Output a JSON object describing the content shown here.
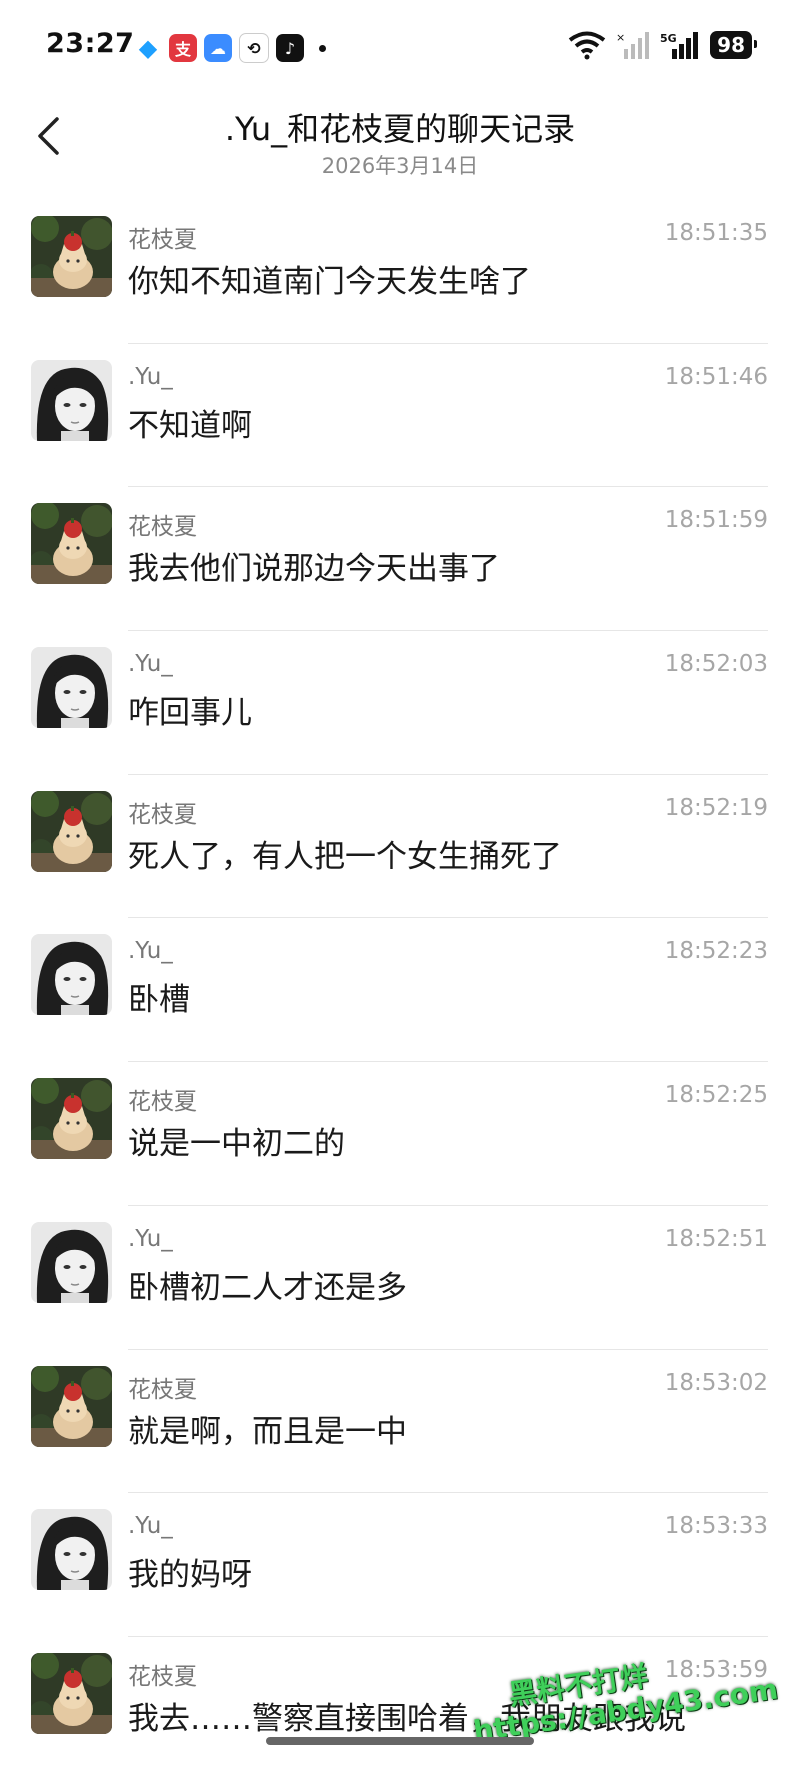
{
  "status_bar": {
    "time": "23:27",
    "app_icons": [
      {
        "name": "qq-icon",
        "color": "#1ea0ff",
        "glyph": "◆"
      },
      {
        "name": "alipay-icon",
        "color": "#e2373f",
        "glyph": "支"
      },
      {
        "name": "weather-icon",
        "color": "#3b8cff",
        "glyph": "☁"
      },
      {
        "name": "sync-app-icon",
        "color": "#ffffff",
        "glyph": "⟲"
      },
      {
        "name": "tiktok-icon",
        "color": "#111111",
        "glyph": "♪"
      }
    ],
    "network": "5G",
    "battery": "98"
  },
  "header": {
    "title": ".Yu_和花枝夏的聊天记录",
    "date": "2026年3月14日"
  },
  "messages": [
    {
      "sender": "花枝夏",
      "time": "18:51:35",
      "text": "你知不知道南门今天发生啥了",
      "avatar": "cat"
    },
    {
      "sender": ".Yu_",
      "time": "18:51:46",
      "text": "不知道啊",
      "avatar": "girl"
    },
    {
      "sender": "花枝夏",
      "time": "18:51:59",
      "text": "我去他们说那边今天出事了",
      "avatar": "cat"
    },
    {
      "sender": ".Yu_",
      "time": "18:52:03",
      "text": "咋回事儿",
      "avatar": "girl"
    },
    {
      "sender": "花枝夏",
      "time": "18:52:19",
      "text": "死人了，有人把一个女生捅死了",
      "avatar": "cat"
    },
    {
      "sender": ".Yu_",
      "time": "18:52:23",
      "text": "卧槽",
      "avatar": "girl"
    },
    {
      "sender": "花枝夏",
      "time": "18:52:25",
      "text": "说是一中初二的",
      "avatar": "cat"
    },
    {
      "sender": ".Yu_",
      "time": "18:52:51",
      "text": "卧槽初二人才还是多",
      "avatar": "girl"
    },
    {
      "sender": "花枝夏",
      "time": "18:53:02",
      "text": "就是啊，而且是一中",
      "avatar": "cat"
    },
    {
      "sender": ".Yu_",
      "time": "18:53:33",
      "text": "我的妈呀",
      "avatar": "girl"
    },
    {
      "sender": "花枝夏",
      "time": "18:53:59",
      "text": "我去……警察直接围哈着，我朋友跟我说",
      "avatar": "cat"
    }
  ],
  "watermark": {
    "line1": "黑料不打烊",
    "line2": "https://abdy43.com"
  }
}
